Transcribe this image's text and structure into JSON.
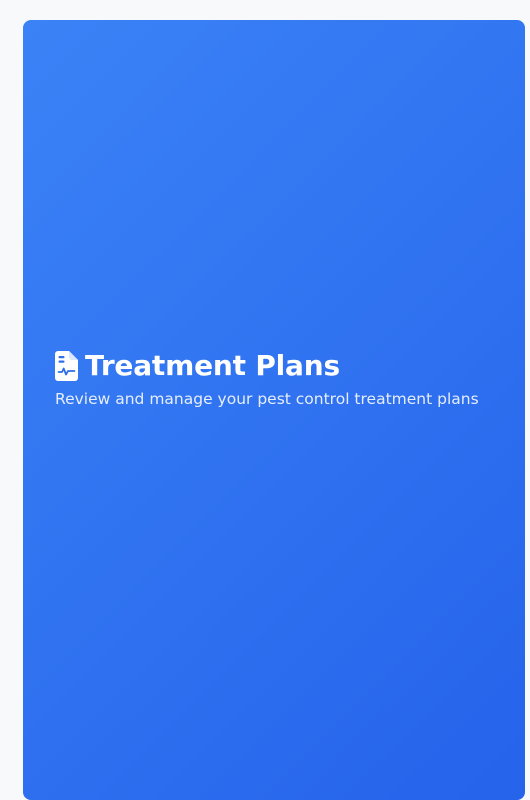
{
  "header": {
    "icon": "file-medical-icon",
    "title": "Treatment Plans",
    "subtitle": "Review and manage your pest control treatment plans"
  },
  "colors": {
    "page_background": "#f8f9fb",
    "hero_gradient_start": "#3b82f6",
    "hero_gradient_end": "#2563eb",
    "title_text": "#ffffff"
  }
}
